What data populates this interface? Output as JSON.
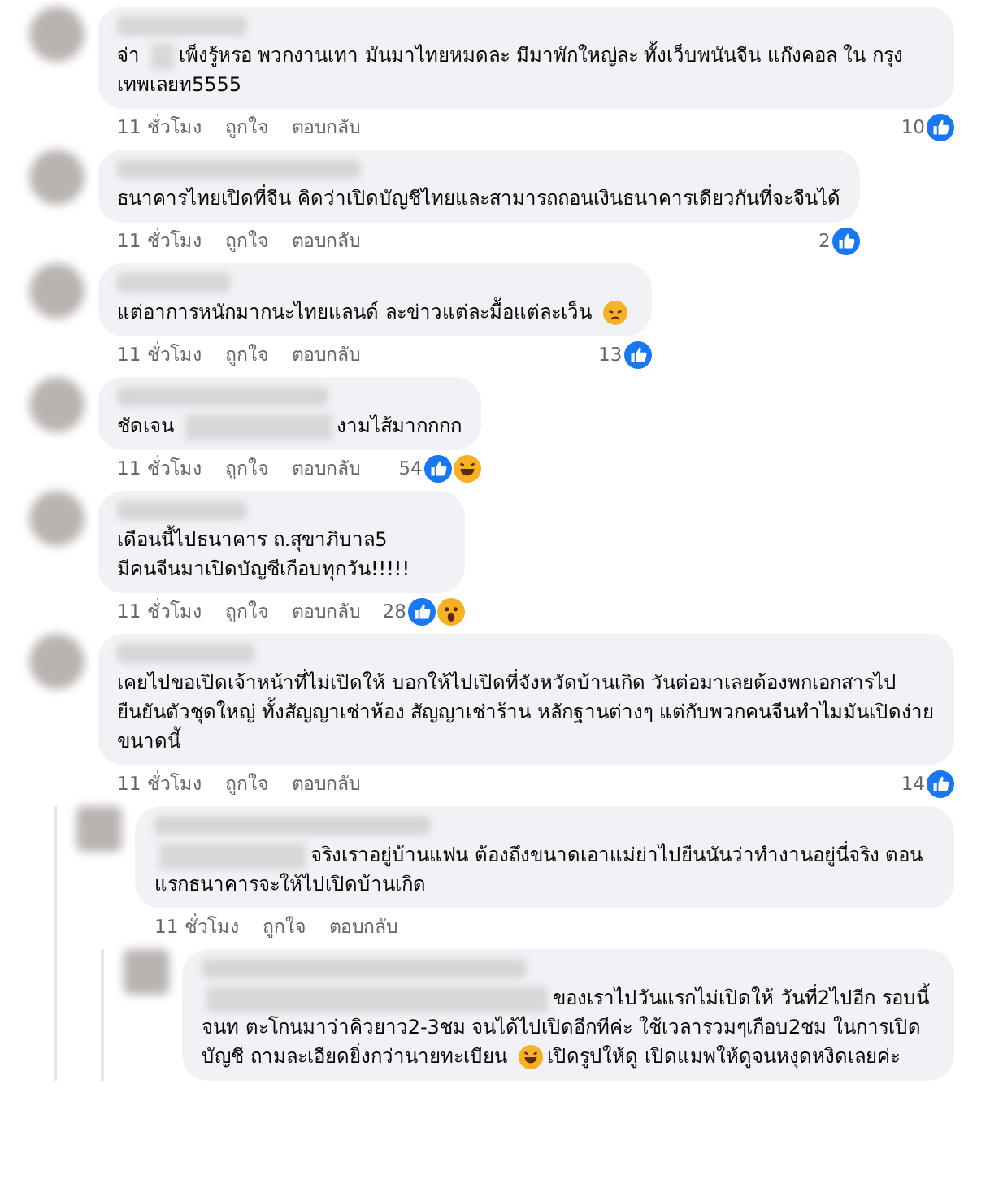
{
  "comments": [
    {
      "parts": [
        {
          "kind": "text",
          "text": "จ่า"
        },
        {
          "kind": "blur"
        },
        {
          "kind": "text",
          "text": "เพ็งรู้หรอ พวกงานเทา มันมาไทยหมดละ มีมาพักใหญ่ละ ทั้งเว็บพนันจีน แก๊งคอล ใน กรุงเทพเลยท5555"
        }
      ],
      "time": "11 ชั่วโมง",
      "like": "ถูกใจ",
      "reply": "ตอบกลับ",
      "count": "10",
      "reactions": [
        {
          "kind": "like"
        }
      ]
    },
    {
      "parts": [
        {
          "kind": "text",
          "text": "ธนาคารไทยเปิดที่จีน คิดว่าเปิดบัญชีไทยและสามารถถอนเงินธนาคารเดียวกันที่จะจีนได้"
        }
      ],
      "time": "11 ชั่วโมง",
      "like": "ถูกใจ",
      "reply": "ตอบกลับ",
      "count": "2",
      "reactions": [
        {
          "kind": "like"
        }
      ]
    },
    {
      "parts": [
        {
          "kind": "text",
          "text": "แต่อาการหนักมากนะไทยแลนด์ ละข่าวแต่ละมื้อแต่ละเว็น"
        },
        {
          "kind": "sad"
        }
      ],
      "time": "11 ชั่วโมง",
      "like": "ถูกใจ",
      "reply": "ตอบกลับ",
      "count": "13",
      "reactions": [
        {
          "kind": "like"
        }
      ]
    },
    {
      "parts": [
        {
          "kind": "text",
          "text": "ชัดเจน"
        },
        {
          "kind": "blur"
        },
        {
          "kind": "text",
          "text": "งามไส้มากกกก"
        }
      ],
      "time": "11 ชั่วโมง",
      "like": "ถูกใจ",
      "reply": "ตอบกลับ",
      "count": "54",
      "reactions": [
        {
          "kind": "like"
        },
        {
          "kind": "haha"
        }
      ]
    },
    {
      "parts": [
        {
          "kind": "text",
          "text": "เดือนนี้ไปธนาคาร ถ.สุขาภิบาล5"
        },
        {
          "kind": "break"
        },
        {
          "kind": "text",
          "text": "มีคนจีนมาเปิดบัญชีเกือบทุกวัน!!!!!"
        }
      ],
      "time": "11 ชั่วโมง",
      "like": "ถูกใจ",
      "reply": "ตอบกลับ",
      "count": "28",
      "reactions": [
        {
          "kind": "like"
        },
        {
          "kind": "wow"
        }
      ]
    },
    {
      "parts": [
        {
          "kind": "text",
          "text": "เคยไปขอเปิดเจ้าหน้าที่ไม่เปิดให้ บอกให้ไปเปิดที่จังหวัดบ้านเกิด วันต่อมาเลยต้องพกเอกสารไปยืนยันตัวชุดใหญ่ ทั้งสัญญาเช่าห้อง สัญญาเช่าร้าน หลักฐานต่างๆ แต่กับพวกคนจีนทำไมมันเปิดง่ายขนาดนี้"
        }
      ],
      "time": "11 ชั่วโมง",
      "like": "ถูกใจ",
      "reply": "ตอบกลับ",
      "count": "14",
      "reactions": [
        {
          "kind": "like"
        }
      ],
      "children": [
        {
          "parts": [
            {
              "kind": "blur"
            },
            {
              "kind": "text",
              "text": "จริงเราอยู่บ้านแฟน ต้องถึงขนาดเอาแม่ย่าไปยืนนันว่าทำงานอยู่นี่จริง ตอนแรกธนาคารจะให้ไปเปิดบ้านเกิด"
            }
          ],
          "time": "11 ชั่วโมง",
          "like": "ถูกใจ",
          "reply": "ตอบกลับ",
          "children": [
            {
              "parts": [
                {
                  "kind": "blur"
                },
                {
                  "kind": "text",
                  "text": "ของเราไปวันแรกไม่เปิดให้ วันที่2ไปอีก รอบนี้จนท ตะโกนมาว่าคิวยาว2-3ชม จนได้ไปเปิดอีกทีค่ะ ใช้เวลารวมๆเกือบ2ชม ในการเปิดบัญชี ถามละเอียดยิ่งกว่านายทะเบียน"
                },
                {
                  "kind": "haha"
                },
                {
                  "kind": "text",
                  "text": "เปิดรูปให้ดู เปิดแมพให้ดูจนหงุดหงิดเลยค่ะ"
                }
              ]
            }
          ]
        }
      ]
    }
  ]
}
